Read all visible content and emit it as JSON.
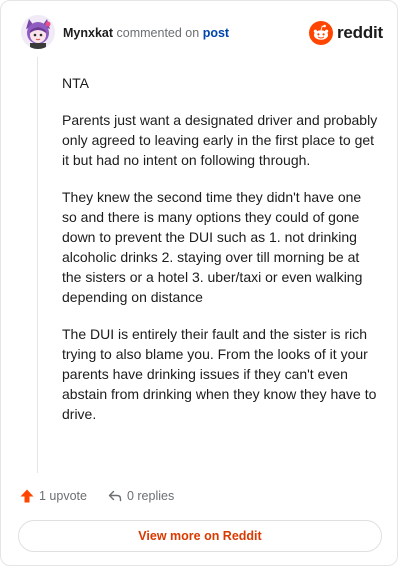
{
  "header": {
    "author": "Mynxkat",
    "action_text": "commented on",
    "post_link": "post",
    "brand": "reddit",
    "avatar_icon": "avatar-cat-girl",
    "brand_color": "#ff4500"
  },
  "comment": {
    "paragraphs": [
      "NTA",
      "Parents just want a designated driver and probably only agreed to leaving early in the first place to get it but had no intent on following through.",
      "They knew the second time they didn't have one so and there is many options they could of gone down to prevent the DUI such as 1. not drinking alcoholic drinks 2. staying over till morning be at the sisters or a hotel 3. uber/taxi or even walking depending on distance",
      "The DUI is entirely their fault and the sister is rich trying to also blame you. From the looks of it your parents have drinking issues if they can't even abstain from drinking when they know they have to drive."
    ]
  },
  "footer": {
    "upvote_count": "1 upvote",
    "reply_count": "0 replies",
    "upvote_icon": "upvote-arrow-icon",
    "reply_icon": "reply-arrow-icon",
    "upvote_color": "#ff4500"
  },
  "cta": {
    "label": "View more on Reddit",
    "color": "#d93a00"
  }
}
